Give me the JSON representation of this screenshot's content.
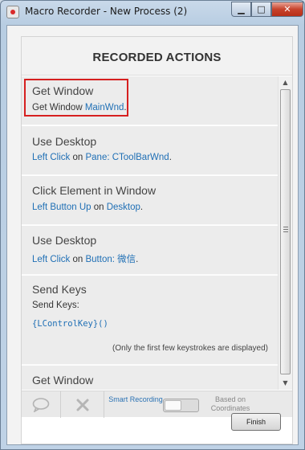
{
  "window": {
    "title": "Macro Recorder - New Process (2)",
    "minimize_glyph": "▁",
    "maximize_glyph": "□",
    "close_glyph": "✕"
  },
  "panel": {
    "header": "RECORDED ACTIONS"
  },
  "actions": [
    {
      "title": "Get Window",
      "desc_prefix": "Get Window ",
      "desc_link": "MainWnd",
      "desc_suffix": "."
    },
    {
      "title": "Use Desktop",
      "desc_link1": "Left Click",
      "desc_mid": " on ",
      "desc_link2": "Pane: CToolBarWnd",
      "desc_suffix": "."
    },
    {
      "title": "Click Element in Window",
      "desc_link1": "Left Button Up",
      "desc_mid": " on ",
      "desc_link2": "Desktop",
      "desc_suffix": "."
    },
    {
      "title": "Use Desktop",
      "desc_link1": "Left Click",
      "desc_mid": " on ",
      "desc_link2": "Button: 微信",
      "desc_suffix": "."
    },
    {
      "title": "Send Keys",
      "desc": "Send Keys:",
      "keys": "{LControlKey}()",
      "note": "(Only the first few keystrokes are displayed)"
    },
    {
      "title": "Get Window"
    }
  ],
  "toolbar": {
    "comment_icon": "speech-bubble-icon",
    "delete_icon": "cross-icon",
    "smart_recording_label": "Smart Recording",
    "coords_label": "Based on Coordinates",
    "smart_recording_on": false
  },
  "footer": {
    "finish_label": "Finish"
  },
  "colors": {
    "link": "#1f6fb5",
    "highlight": "#d62020",
    "item_bg": "#ececec"
  }
}
